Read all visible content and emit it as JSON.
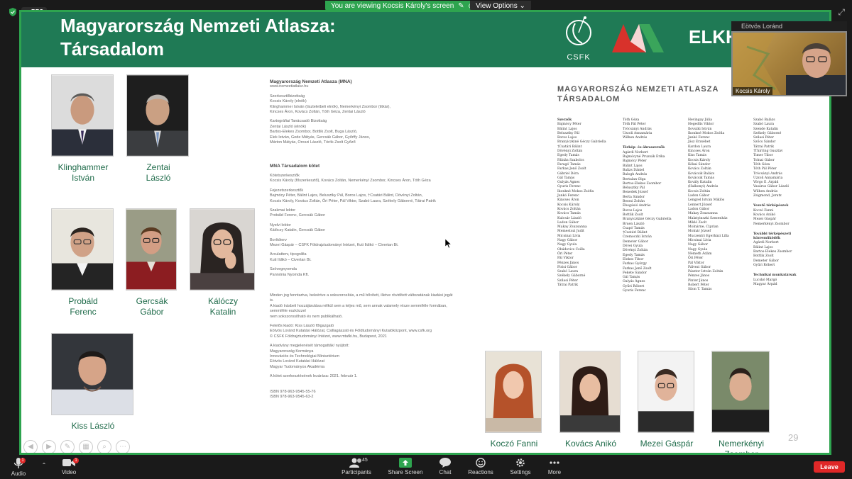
{
  "topbar": {
    "rec_label": "REC",
    "viewing_text": "You are viewing Kocsis Károly's screen",
    "view_options_label": "View Options"
  },
  "slide": {
    "title_line1": "Magyarország Nemzeti Atlasza:",
    "title_line2": "Társadalom",
    "logo_csfk_text": "CSFK",
    "logo_mna_text": "MNA",
    "logo_elkh_text": "ELKH",
    "page_number": "29",
    "people_left": [
      {
        "first": "Klinghammer",
        "last": "István"
      },
      {
        "first": "Zentai",
        "last": "László"
      },
      {
        "first": "Probáld",
        "last": "Ferenc"
      },
      {
        "first": "Gercsák",
        "last": "Gábor"
      },
      {
        "first": "Kálóczy",
        "last": "Katalin"
      },
      {
        "first": "Kiss László",
        "last": ""
      }
    ],
    "people_bottom": [
      "Koczó Fanni",
      "Kovács Anikó",
      "Mezei Gáspár",
      "Nemerkényi Zsombor"
    ],
    "doc": {
      "h1": "Magyarország Nemzeti Atlasza (MNA)",
      "url": "www.nemzetiatlasz.hu",
      "s1_title": "Szerkesztőbizottság",
      "s1_lines": [
        "Kocsis Károly (elnök)",
        "Klinghammer István (tiszteletbeli elnök), Nemerkényi Zsombor (titkár),",
        "Kincses Áron, Kovács Zoltán, Tóth Géza, Zentai László"
      ],
      "s2_title": "Kartográfiai Tanácsadó Bizottság",
      "s2_lines": [
        "Zentai László (elnök)",
        "Bartos-Elekes Zsombor, Bottlik Zsolt, Buga László,",
        "Elek István, Gede Mátyás, Gercsák Gábor, Győrffy János,",
        "Márton Mátyás, Oroszi László, Török Zsolt Győző"
      ],
      "h2": "MNA Társadalom kötet",
      "s3_title": "Kötetszerkesztők",
      "s3_lines": [
        "Kocsis Károly (főszerkesztő), Kovács Zoltán, Nemerkényi Zsombor, Kincses Áron, Tóth Géza"
      ],
      "s4_title": "Fejezetszerkesztők",
      "s4_lines": [
        "Bajmócy Péter, Bálint Lajos, Belusztky Pál, Boros Lajos, †Csatári Bálint, Dövényi Zoltán,",
        "Kocsis Károly, Kovács Zoltán, Őri Péter, Pál Viktor, Szabó Laura, Székely Gáborné, Tátrai Patrik"
      ],
      "s5_title": "Szakmai lektor",
      "s5_lines": [
        "Probáld Ferenc, Gercsák Gábor"
      ],
      "s6_title": "Nyelvi lektor",
      "s6_lines": [
        "Kálóczy Katalin, Gercsák Gábor"
      ],
      "s7_title": "Borítóterv",
      "s7_lines": [
        "Mezei Gáspár – CSFK Földrajztudományi Intézet, Kuti Ildikó – Civertan Bt."
      ],
      "s8_title": "Arculatterv, tipográfia",
      "s8_lines": [
        "Kuti Ildikó – Civertan Bt."
      ],
      "s9_title": "Szövegnyomda",
      "s9_lines": [
        "Pannónia Nyomda Kft."
      ],
      "s10_lines": [
        "Minden jog fenntartva, beleértve a sokszorosítás, a mű bővített, illetve rövidített változatának kiadási jogát is.",
        "A kiadó írásbeli hozzájárulása nélkül sem a teljes mű, sem annak valamely része semmiféle formában, semmiféle eszközzel",
        "nem sokszorosítható és nem publikálható."
      ],
      "s11_lines": [
        "Felelős kiadó: Kiss László főigazgató",
        "Eötvös Loránd Kutatási Hálózat, Csillagászati és Földtudományi Kutatóközpont, www.csfk.org",
        "© CSFK Földrajztudományi Intézet, www.mtafki.hu, Budapest, 2021"
      ],
      "s12_lines": [
        "A kiadvány megjelenését támogatták/ nyújtott:",
        "Magyarország Kormánya",
        "Innovációs és Technológiai Minisztérium",
        "Eötvös Loránd Kutatási Hálózat",
        "Magyar Tudományos Akadémia"
      ],
      "s13_lines": [
        "A kötet szerkesztésének lezárása: 2021. február 1."
      ],
      "s14_lines": [
        "ISBN 978-963-9545-55-76",
        "ISBN 978-963-9545-63-2"
      ]
    },
    "credits_title_1": "MAGYARORSZÁG NEMZETI ATLASZA",
    "credits_title_2": "TÁRSADALOM",
    "credits": [
      {
        "heading": "Szerzők",
        "names": [
          "Bajmócy Péter",
          "Bálint Lajos",
          "Belusztky Pál",
          "Boros Lajos",
          "Branyiczkiné Géczy Gabriella",
          "†Csatári Bálint",
          "Dövényi Zoltán",
          "Egedy Tamás",
          "Fábián Szabolcs",
          "Faragó Tamás",
          "Farkas Jenő Zsolt",
          "Gábriel Dóra",
          "Gál Tamás",
          "Gulyás Ágnes",
          "Gyuris Ferenc",
          "Ikonkné Mokos Zsófia",
          "Jankó Ferenc",
          "Kincses Áron",
          "Kocsis Károly",
          "Kovács Zoltán",
          "Kovács Tamás",
          "Kulcsár László",
          "Ladon Gábor",
          "Makay Zsuzsanna",
          "Memestozi Judit",
          "Micsinai Lívia",
          "Nagy Gábor",
          "Nagy Gyula",
          "Obádovics Csilla",
          "Őri Péter",
          "Pál Viktor",
          "Pénzes János",
          "Pirisi Gábor",
          "Szabó Laura",
          "Székely Gáborné",
          "Szilasi Péter",
          "Tátrai Patrik"
        ]
      },
      {
        "heading": "",
        "names": [
          "Tóth Géza",
          "Tóth Pál Péter",
          "Trócsányi András",
          "Uzzoli Annamária",
          "Wilhen András",
          "",
          "Térkép- és ábraszerzők",
          "Agárdi Norbert",
          "Bajmócyné Pruzsák Erika",
          "Bajmócy Péter",
          "Bálint Lajos",
          "Balizs Dániel",
          "Balogh András",
          "Bertalan Olga",
          "Bertos-Elekes Zsombor",
          "Bélusztky Pál",
          "Benedek József",
          "Berta Sándor",
          "Berzsi Zoltán",
          "Ébogásió András",
          "Boros Lajos",
          "Bottlik Zsolt",
          "Branyiczkiné Géczy Gabriella",
          "Bruen László",
          "Csapó Tamás",
          "†Csatári Bálint",
          "Czemoczki István",
          "Demeter Gábor",
          "Dövei Gyula",
          "Dövényi Zoltán",
          "Egedy Tamás",
          "Elekes Tibor",
          "Farkas György",
          "Farkas Jenő Zsolt",
          "Fekete Sándor",
          "Gál Tamás",
          "Gulyás Ágnes",
          "Gyűri Róbert",
          "Gyuris Ferenc"
        ]
      },
      {
        "heading": "",
        "names": [
          "Hevingay Júlia",
          "Hegedűs Viktor",
          "Ilovszki István",
          "Ikonkné Mokos Zsófia",
          "Jankó Ferenc",
          "Jász Erzsébet",
          "Kardon Laura",
          "Kincses Áron",
          "Kiss Tamás",
          "Kocsis Károly",
          "Kókai Sándor",
          "Kovács Zoltán",
          "Kovácsik Balázs",
          "Kovácsik Tamás",
          "Kovály Katalin",
          "(Halkonyi) András",
          "Kocsis Zoltán",
          "Ladon Gábor",
          "Lengyel István Miklós",
          "Lennert József",
          "Ladon Gábor",
          "Makay Zsuzsanna",
          "Malatyinszki Szezenház",
          "Mikló Zsolt",
          "Molnárne, Ciprian",
          "Molnár József",
          "Muczentri Egerházi Lilla",
          "Micsinai Lívia",
          "Nagy Gábor",
          "Nagy Gyula",
          "Németh Ádám",
          "Őri Péter",
          "Pál Viktor",
          "Pálvezi Gábor",
          "Pásztor István Zoltán",
          "Pénzes János",
          "Pinter János",
          "Robert Péter",
          "Silon T. Tamás"
        ]
      },
      {
        "heading": "",
        "names": [
          "Szabó Balázs",
          "Szabó Laura",
          "Szende Katalin",
          "Székely Gáborné",
          "Szilasi Péter",
          "Szőcs Sándor",
          "Tátrai Patrik",
          "†Thirring Gusztáv",
          "Timer Tibor",
          "Tolnai Gábor",
          "Tóth Géza",
          "Tóth Pál Péter",
          "Trócsányi András",
          "Uzzoli Annamária",
          "Vörgo E. Árpád",
          "Vasárus Gábor László",
          "Wilhen András",
          "Zsigmond, Joratz",
          "",
          "Vezető térképészek",
          "Koczó Fanni",
          "Kovács Anikó",
          "Mezei Gáspár",
          "Nemerkényi Zsombor",
          "",
          "További térképészeti közreműködők",
          "Agárdi Norbert",
          "Bálint Lajos",
          "Bartos-Elekes Zsombor",
          "Bottlik Zsolt",
          "Demeter Gábor",
          "Gyűri Róbert",
          "",
          "Technikai munkatársak",
          "Lucskó Margó",
          "Magyar Árpád"
        ]
      }
    ]
  },
  "participant": {
    "label_over": "Eötvös Loránd",
    "name": "Kocsis Károly"
  },
  "toolbar": {
    "audio_label": "Audio",
    "video_label": "Video",
    "participants_label": "Participants",
    "participants_count": "45",
    "share_label": "Share Screen",
    "chat_label": "Chat",
    "reactions_label": "Reactions",
    "settings_label": "Settings",
    "more_label": "More",
    "leave_label": "Leave",
    "audio_badge": "1",
    "video_badge": "1"
  },
  "colors": {
    "accent_green": "#2ea44f",
    "slide_header": "#1f7a55",
    "name_text": "#1f6b4a",
    "leave_red": "#e02828"
  }
}
